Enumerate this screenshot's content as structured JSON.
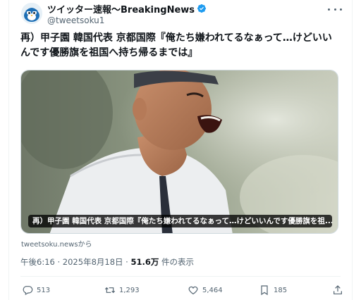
{
  "account": {
    "display_name": "ツイッター速報〜BreakingNews",
    "handle": "@tweetsoku1",
    "verified": true,
    "avatar_icon": "bird-icon"
  },
  "tweet": {
    "text": "再）甲子園 韓国代表 京都国際『俺たち嫌われてるなぁって…けどいいんです優勝旗を祖国へ持ち帰るまでは』",
    "media_caption": "再）甲子園 韓国代表 京都国際『俺たち嫌われてるなぁって…けどいいんです優勝旗を祖...",
    "source": "tweetsoku.newsから",
    "time": "午後6:16",
    "date": "2025年8月18日",
    "views_count": "51.6万",
    "views_label": "件の表示",
    "separator": "·"
  },
  "actions": {
    "replies": "513",
    "retweets": "1,293",
    "likes": "5,464",
    "bookmarks": "185"
  },
  "colors": {
    "verified": "#1d9bf0",
    "text": "#0f1419",
    "secondary": "#536471",
    "border": "#eff3f4"
  }
}
